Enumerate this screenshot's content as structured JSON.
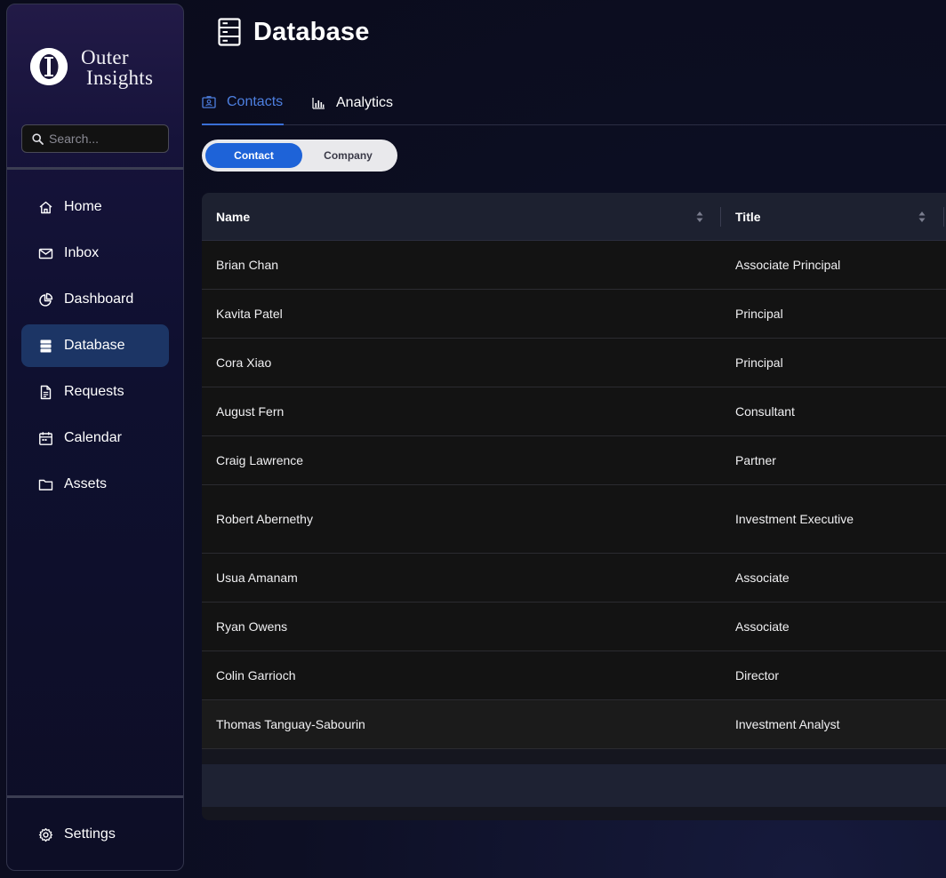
{
  "brand": {
    "line1": "Outer",
    "line2": "Insights",
    "logo_icon": "circle-i-logo"
  },
  "search": {
    "placeholder": "Search...",
    "value": ""
  },
  "sidebar": {
    "items": [
      {
        "label": "Home",
        "icon": "home-icon",
        "active": false
      },
      {
        "label": "Inbox",
        "icon": "mail-icon",
        "active": false
      },
      {
        "label": "Dashboard",
        "icon": "pie-chart-icon",
        "active": false
      },
      {
        "label": "Database",
        "icon": "database-icon",
        "active": true
      },
      {
        "label": "Requests",
        "icon": "document-icon",
        "active": false
      },
      {
        "label": "Calendar",
        "icon": "calendar-icon",
        "active": false
      },
      {
        "label": "Assets",
        "icon": "folder-icon",
        "active": false
      }
    ],
    "settings_label": "Settings"
  },
  "page": {
    "title": "Database",
    "title_icon": "server-icon"
  },
  "tabs": [
    {
      "label": "Contacts",
      "icon": "contact-card-icon",
      "active": true
    },
    {
      "label": "Analytics",
      "icon": "bar-chart-icon",
      "active": false
    }
  ],
  "toggle": {
    "options": [
      "Contact",
      "Company"
    ],
    "selected": "Contact"
  },
  "table": {
    "columns": [
      "Name",
      "Title"
    ],
    "rows": [
      {
        "name": "Brian Chan",
        "title": "Associate Principal"
      },
      {
        "name": "Kavita Patel",
        "title": "Principal"
      },
      {
        "name": "Cora Xiao",
        "title": "Principal"
      },
      {
        "name": "August Fern",
        "title": "Consultant"
      },
      {
        "name": "Craig Lawrence",
        "title": "Partner"
      },
      {
        "name": "Robert Abernethy",
        "title": "Investment Executive"
      },
      {
        "name": "Usua Amanam",
        "title": "Associate"
      },
      {
        "name": "Ryan Owens",
        "title": "Associate"
      },
      {
        "name": "Colin Garrioch",
        "title": "Director"
      },
      {
        "name": "Thomas Tanguay-Sabourin",
        "title": "Investment Analyst"
      }
    ]
  },
  "colors": {
    "accent": "#1e63d8",
    "active_nav": "#1c3565",
    "tab_active": "#4d7fe0"
  }
}
